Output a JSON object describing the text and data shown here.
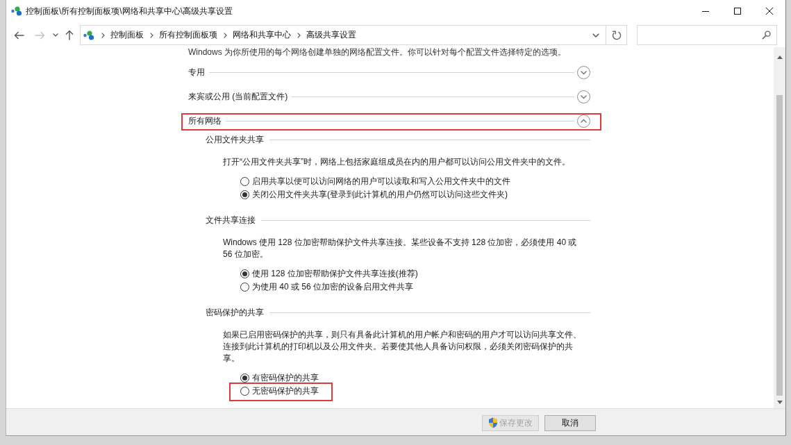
{
  "window": {
    "title": "控制面板\\所有控制面板项\\网络和共享中心\\高级共享设置"
  },
  "navigation": [
    {
      "kind": "back",
      "disabled": false
    },
    {
      "kind": "forward",
      "disabled": true
    },
    {
      "kind": "recent",
      "disabled": false
    },
    {
      "kind": "up",
      "disabled": false
    }
  ],
  "address_bar": {
    "breadcrumbs": [
      "控制面板",
      "所有控制面板项",
      "网络和共享中心",
      "高级共享设置"
    ]
  },
  "intro": "Windows 为你所使用的每个网络创建单独的网络配置文件。你可以针对每个配置文件选择特定的选项。",
  "profiles": [
    {
      "title": "专用",
      "expanded": false,
      "highlighted": false
    },
    {
      "title": "来宾或公用 (当前配置文件)",
      "expanded": false,
      "highlighted": false
    },
    {
      "title": "所有网络",
      "expanded": true,
      "highlighted": true,
      "groups": [
        {
          "title": "公用文件夹共享",
          "description": "打开“公用文件夹共享”时，网络上包括家庭组成员在内的用户都可以访问公用文件夹中的文件。",
          "options": [
            {
              "label": "启用共享以便可以访问网络的用户可以读取和写入公用文件夹中的文件",
              "selected": false,
              "highlighted": false
            },
            {
              "label": "关闭公用文件夹共享(登录到此计算机的用户仍然可以访问这些文件夹)",
              "selected": true,
              "highlighted": false
            }
          ]
        },
        {
          "title": "文件共享连接",
          "description": "Windows 使用 128 位加密帮助保护文件共享连接。某些设备不支持 128 位加密，必须使用 40 或 56 位加密。",
          "options": [
            {
              "label": "使用 128 位加密帮助保护文件共享连接(推荐)",
              "selected": true,
              "highlighted": false
            },
            {
              "label": "为使用 40 或 56 位加密的设备启用文件共享",
              "selected": false,
              "highlighted": false
            }
          ]
        },
        {
          "title": "密码保护的共享",
          "description": "如果已启用密码保护的共享，则只有具备此计算机的用户帐户和密码的用户才可以访问共享文件、连接到此计算机的打印机以及公用文件夹。若要使其他人具备访问权限，必须关闭密码保护的共享。",
          "options": [
            {
              "label": "有密码保护的共享",
              "selected": true,
              "highlighted": false
            },
            {
              "label": "无密码保护的共享",
              "selected": false,
              "highlighted": true
            }
          ]
        }
      ]
    }
  ],
  "buttons": [
    {
      "label": "保存更改",
      "kind": "elevated",
      "disabled": true
    },
    {
      "label": "取消",
      "kind": "plain",
      "disabled": false
    }
  ]
}
